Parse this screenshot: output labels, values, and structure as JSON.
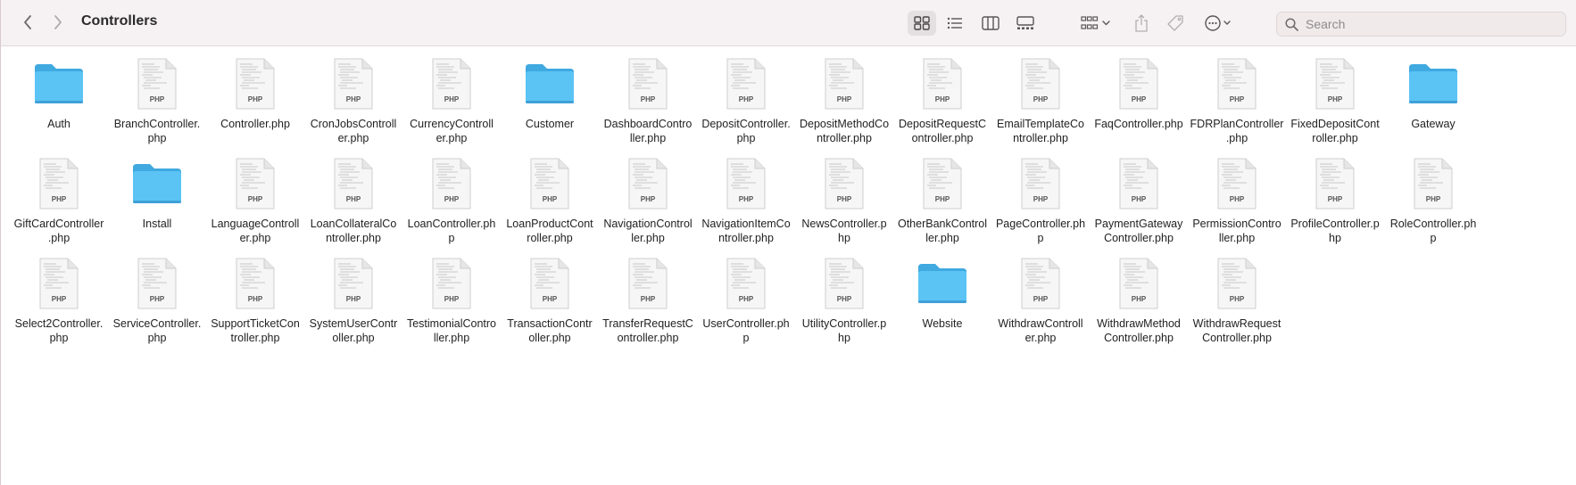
{
  "window": {
    "title": "Controllers"
  },
  "toolbar": {
    "back_icon": "chevron-left-icon",
    "forward_icon": "chevron-right-icon",
    "view_buttons": [
      "icon-view-icon",
      "list-view-icon",
      "column-view-icon",
      "gallery-view-icon"
    ],
    "group_icon": "group-by-icon",
    "share_icon": "share-icon",
    "tag_icon": "tag-icon",
    "more_icon": "ellipsis-circle-icon"
  },
  "search": {
    "placeholder": "Search"
  },
  "colors": {
    "folder": "#5bc4f5",
    "folder_dark": "#3fa9e0",
    "toolbar_bg": "#f6f1f2"
  },
  "files": [
    {
      "type": "folder",
      "label": "Auth"
    },
    {
      "type": "php",
      "label": "BranchController.\nphp"
    },
    {
      "type": "php",
      "label": "Controller.php"
    },
    {
      "type": "php",
      "label": "CronJobsControll\ner.php"
    },
    {
      "type": "php",
      "label": "CurrencyControll\ner.php"
    },
    {
      "type": "folder",
      "label": "Customer"
    },
    {
      "type": "php",
      "label": "DashboardContro\nller.php"
    },
    {
      "type": "php",
      "label": "DepositController.\nphp"
    },
    {
      "type": "php",
      "label": "DepositMethodCo\nntroller.php"
    },
    {
      "type": "php",
      "label": "DepositRequestC\nontroller.php"
    },
    {
      "type": "php",
      "label": "EmailTemplateCo\nntroller.php"
    },
    {
      "type": "php",
      "label": "FaqController.php"
    },
    {
      "type": "php",
      "label": "FDRPlanController\n.php"
    },
    {
      "type": "php",
      "label": "FixedDepositCont\nroller.php"
    },
    {
      "type": "folder",
      "label": "Gateway"
    },
    {
      "type": "php",
      "label": "GiftCardController\n.php"
    },
    {
      "type": "folder",
      "label": "Install"
    },
    {
      "type": "php",
      "label": "LanguageControll\ner.php"
    },
    {
      "type": "php",
      "label": "LoanCollateralCo\nntroller.php"
    },
    {
      "type": "php",
      "label": "LoanController.ph\np"
    },
    {
      "type": "php",
      "label": "LoanProductCont\nroller.php"
    },
    {
      "type": "php",
      "label": "NavigationControl\nler.php"
    },
    {
      "type": "php",
      "label": "NavigationItemCo\nntroller.php"
    },
    {
      "type": "php",
      "label": "NewsController.p\nhp"
    },
    {
      "type": "php",
      "label": "OtherBankControl\nler.php"
    },
    {
      "type": "php",
      "label": "PageController.ph\np"
    },
    {
      "type": "php",
      "label": "PaymentGateway\nController.php"
    },
    {
      "type": "php",
      "label": "PermissionContro\nller.php"
    },
    {
      "type": "php",
      "label": "ProfileController.p\nhp"
    },
    {
      "type": "php",
      "label": "RoleController.ph\np"
    },
    {
      "type": "php",
      "label": "Select2Controller.\nphp"
    },
    {
      "type": "php",
      "label": "ServiceController.\nphp"
    },
    {
      "type": "php",
      "label": "SupportTicketCon\ntroller.php"
    },
    {
      "type": "php",
      "label": "SystemUserContr\noller.php"
    },
    {
      "type": "php",
      "label": "TestimonialContro\nller.php"
    },
    {
      "type": "php",
      "label": "TransactionContr\noller.php"
    },
    {
      "type": "php",
      "label": "TransferRequestC\nontroller.php"
    },
    {
      "type": "php",
      "label": "UserController.ph\np"
    },
    {
      "type": "php",
      "label": "UtilityController.p\nhp"
    },
    {
      "type": "folder",
      "label": "Website"
    },
    {
      "type": "php",
      "label": "WithdrawControll\ner.php"
    },
    {
      "type": "php",
      "label": "WithdrawMethod\nController.php"
    },
    {
      "type": "php",
      "label": "WithdrawRequest\nController.php"
    }
  ],
  "php_badge": "PHP"
}
